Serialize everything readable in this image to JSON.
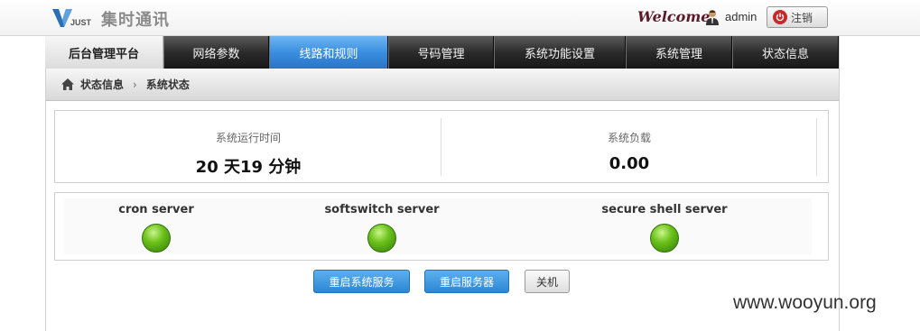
{
  "header": {
    "logo_sub": "JUST",
    "logo_text": "集时通讯",
    "welcome": "Welcome",
    "username": "admin",
    "logout_label": "注销"
  },
  "nav": {
    "brand": "后台管理平台",
    "tabs": [
      {
        "label": "网络参数",
        "active": false
      },
      {
        "label": "线路和规则",
        "active": true
      },
      {
        "label": "号码管理",
        "active": false
      },
      {
        "label": "系统功能设置",
        "active": false
      },
      {
        "label": "系统管理",
        "active": false
      },
      {
        "label": "状态信息",
        "active": false
      }
    ]
  },
  "breadcrumb": {
    "parent": "状态信息",
    "separator": "›",
    "current": "系统状态"
  },
  "stats": [
    {
      "label": "系统运行时间",
      "value": "20 天19 分钟"
    },
    {
      "label": "系统负载",
      "value": "0.00"
    }
  ],
  "services": [
    {
      "name": "cron server",
      "status": "running"
    },
    {
      "name": "softswitch server",
      "status": "running"
    },
    {
      "name": "secure shell server",
      "status": "running"
    }
  ],
  "actions": {
    "restart_services": "重启系统服务",
    "restart_server": "重启服务器",
    "shutdown": "关机"
  },
  "watermark": "www.wooyun.org",
  "colors": {
    "accent": "#3a8fe0",
    "nav_dark": "#2b2b2b",
    "status_ok": "#6cc21b"
  }
}
